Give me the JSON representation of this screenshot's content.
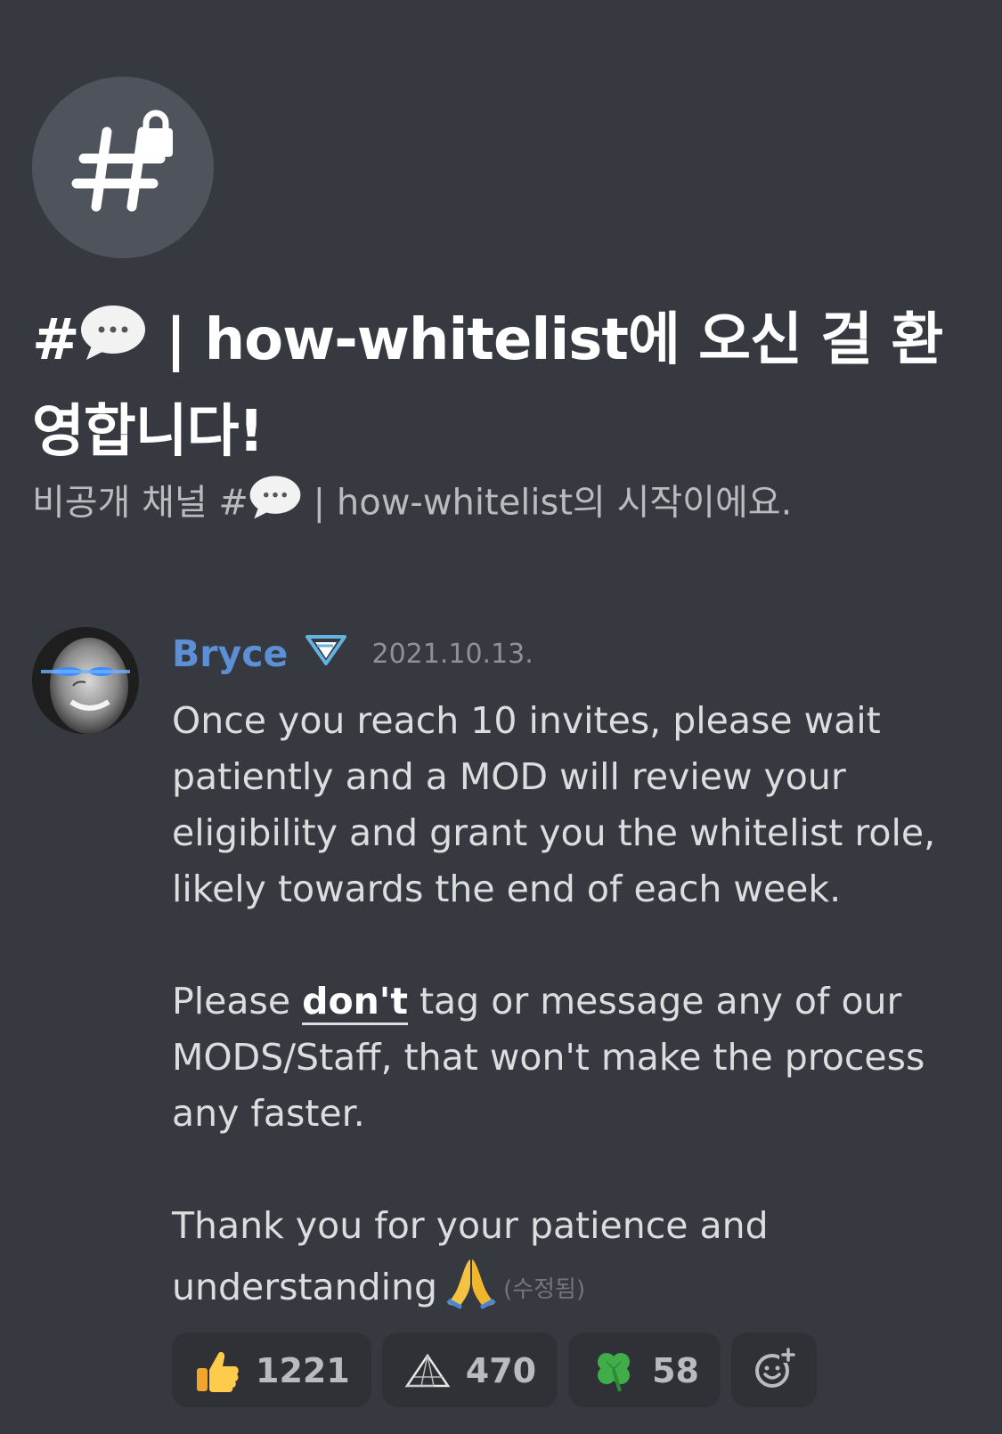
{
  "channel": {
    "icon": "hashtag-lock-icon",
    "title_prefix": "#",
    "title_emoji": "speech-bubble-icon",
    "title_rest": "| how-whitelist에 오신 걸 환영합니다!",
    "subtitle_prefix": "비공개 채널 #",
    "subtitle_rest": "| how-whitelist의 시작이에요."
  },
  "message": {
    "author": "Bryce",
    "author_color": "#5d8fd6",
    "badge_icon": "verified-badge-icon",
    "timestamp": "2021.10.13.",
    "paragraph1": "Once you reach 10 invites, please wait patiently and a MOD will review your eligibility and grant you the whitelist role, likely towards the end of each week.",
    "paragraph2_before": "Please ",
    "paragraph2_bold": "don't",
    "paragraph2_after": " tag or message any of our MODS/Staff, that won't make the process any faster.",
    "paragraph3": "Thank you for your patience and understanding",
    "paragraph3_emoji": "praying-hands-icon",
    "edited_label": "(수정됨)"
  },
  "reactions": [
    {
      "icon": "thumbs-up-icon",
      "count": "1221"
    },
    {
      "icon": "triangle-icon",
      "count": "470"
    },
    {
      "icon": "four-leaf-clover-icon",
      "count": "58"
    }
  ],
  "add_reaction_icon": "add-reaction-icon",
  "colors": {
    "background": "#36393f",
    "reaction_bg": "#2f3136",
    "icon_circle": "#4f545c"
  }
}
